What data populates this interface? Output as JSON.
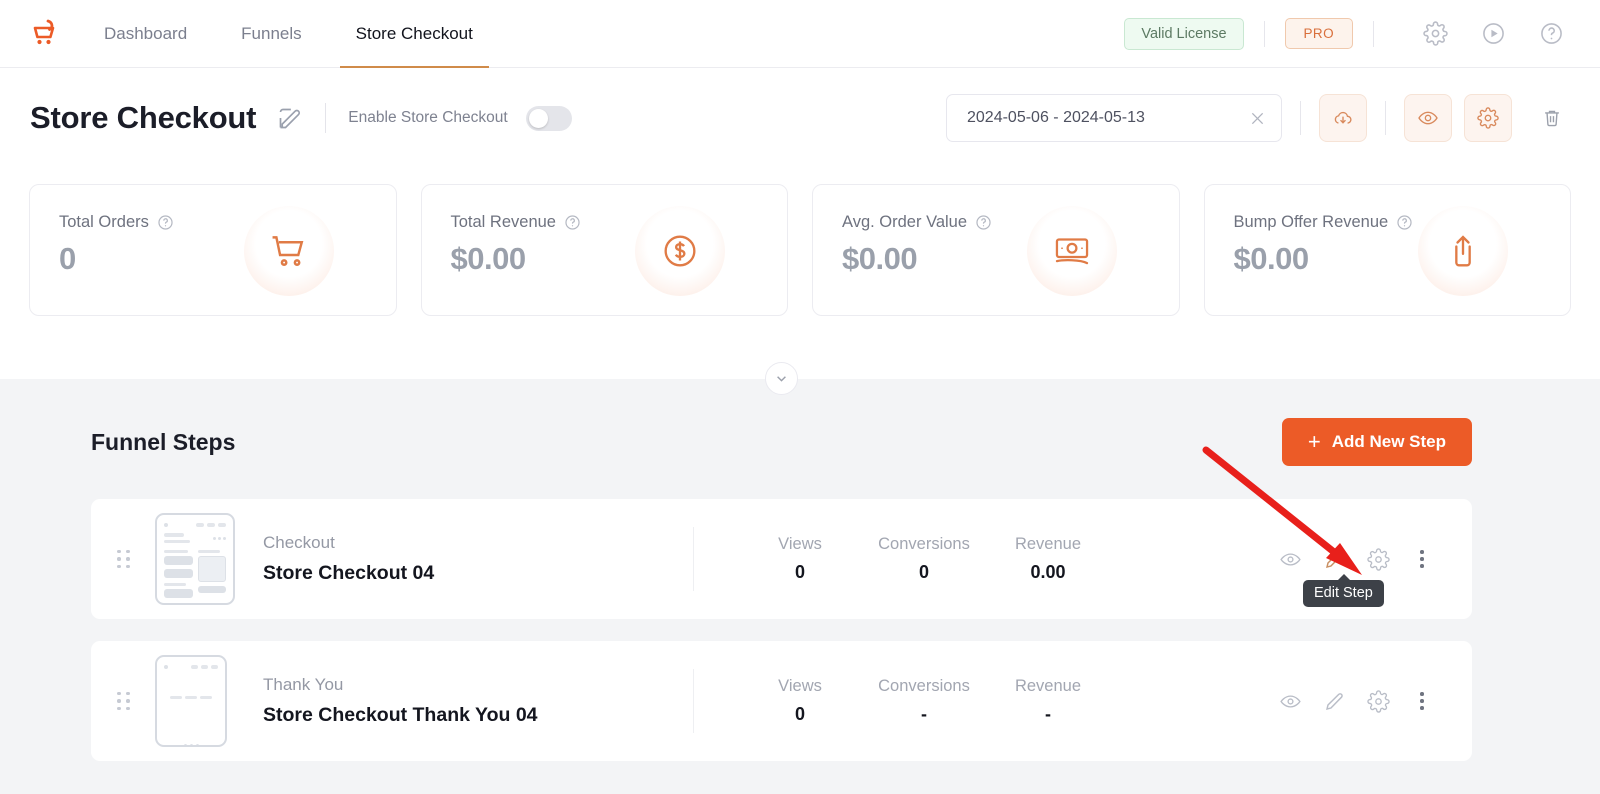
{
  "nav": {
    "brand_icon": "cartflows-logo-icon",
    "links": [
      {
        "label": "Dashboard",
        "active": false
      },
      {
        "label": "Funnels",
        "active": false
      },
      {
        "label": "Store Checkout",
        "active": true
      }
    ],
    "license_badge": "Valid License",
    "pro_badge": "PRO",
    "icons": [
      "gear-icon",
      "play-circle-icon",
      "help-circle-icon"
    ]
  },
  "header": {
    "title": "Store Checkout",
    "edit_icon": "edit-pencil-icon",
    "enable_label": "Enable Store Checkout",
    "toggle_state": "off",
    "date_range": "2024-05-06 - 2024-05-13",
    "date_clear_icon": "close-x-icon",
    "actions": [
      "cloud-download-icon",
      "eye-icon",
      "gear-icon"
    ],
    "trash_icon": "trash-icon"
  },
  "stats": [
    {
      "label": "Total Orders",
      "value": "0",
      "icon": "shopping-cart-icon",
      "help": "help-circle-icon"
    },
    {
      "label": "Total Revenue",
      "value": "$0.00",
      "icon": "dollar-circle-icon",
      "help": "help-circle-icon"
    },
    {
      "label": "Avg. Order Value",
      "value": "$0.00",
      "icon": "money-bill-icon",
      "help": "help-circle-icon"
    },
    {
      "label": "Bump Offer Revenue",
      "value": "$0.00",
      "icon": "share-upload-icon",
      "help": "help-circle-icon"
    }
  ],
  "collapse_icon": "chevron-down-icon",
  "funnel": {
    "title": "Funnel Steps",
    "add_button": "Add New Step",
    "add_button_color": "#ec5b27",
    "metric_headers": [
      "Views",
      "Conversions",
      "Revenue"
    ],
    "steps": [
      {
        "type": "Checkout",
        "name": "Store Checkout 04",
        "views": "0",
        "conversions": "0",
        "revenue": "0.00",
        "actions": [
          "eye-icon",
          "edit-pencil-icon",
          "gear-icon",
          "kebab-menu-icon"
        ],
        "edit_highlighted": true
      },
      {
        "type": "Thank You",
        "name": "Store Checkout Thank You 04",
        "views": "0",
        "conversions": "-",
        "revenue": "-",
        "actions": [
          "eye-icon",
          "edit-pencil-icon",
          "gear-icon",
          "kebab-menu-icon"
        ],
        "edit_highlighted": false
      }
    ]
  },
  "tooltip": {
    "text": "Edit Step"
  },
  "annotation": {
    "arrow_color": "#e8201b",
    "from": "1205,450",
    "to": "1358,572"
  }
}
